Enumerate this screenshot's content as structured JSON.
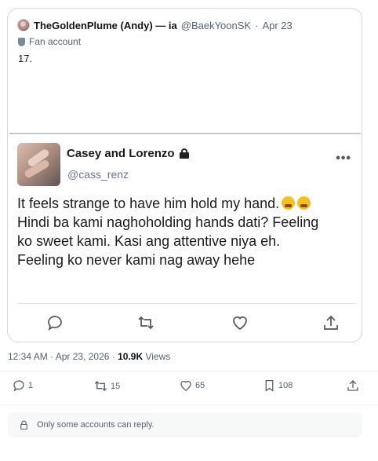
{
  "quote": {
    "display_name": "TheGoldenPlume (Andy) — ia",
    "handle": "@BaekYoonSK",
    "separator": "·",
    "date": "Apr 23",
    "badge": "Fan account",
    "text": "17."
  },
  "embedded_post": {
    "display_name": "Casey and Lorenzo",
    "handle": "@cass_renz",
    "more": "•••",
    "lines": [
      "It feels strange to have him hold my hand.",
      "Hindi ba kami naghoholding hands dati? Feeling",
      "ko sweet kami. Kasi ang attentive niya eh.",
      "Feeling ko never kami nag away hehe"
    ],
    "emoji_icon": "crying-face-emoji"
  },
  "meta": {
    "timestamp": "12:34 AM · Apr 23, 2026 · ",
    "views_count": "10.9K",
    "views_label": " Views"
  },
  "actions": {
    "replies": "1",
    "reposts": "15",
    "likes": "65",
    "bookmarks": "108"
  },
  "reply_restriction": "Only some accounts can reply.",
  "colors": {
    "text_primary": "#0f1419",
    "text_secondary": "#536471",
    "border": "#cfd9de"
  }
}
